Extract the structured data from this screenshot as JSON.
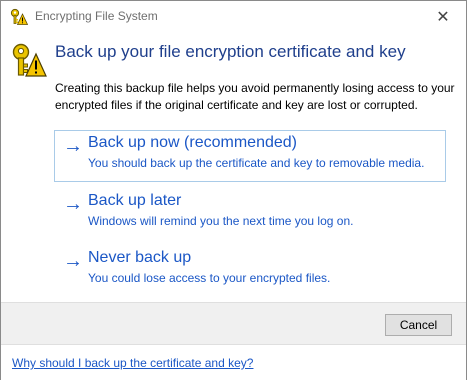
{
  "window": {
    "title": "Encrypting File System",
    "close_glyph": "✕"
  },
  "header": {
    "heading": "Back up your file encryption certificate and key",
    "description": "Creating this backup file helps you avoid permanently losing access to your encrypted files if the original certificate and key are lost or corrupted."
  },
  "options": [
    {
      "arrow": "→",
      "title": "Back up now (recommended)",
      "subtitle": "You should back up the certificate and key to removable media.",
      "selected": true
    },
    {
      "arrow": "→",
      "title": "Back up later",
      "subtitle": "Windows will remind you the next time you log on.",
      "selected": false
    },
    {
      "arrow": "→",
      "title": "Never back up",
      "subtitle": "You could lose access to your encrypted files.",
      "selected": false
    }
  ],
  "footer": {
    "cancel_label": "Cancel"
  },
  "help": {
    "link_text": "Why should I back up the certificate and key?"
  },
  "icons": {
    "title_icon": "key-warning-icon",
    "header_icon": "key-warning-icon"
  },
  "colors": {
    "link_blue": "#1b57c6",
    "heading_blue": "#1f3f8c",
    "selection_border": "#a9cbe8"
  }
}
